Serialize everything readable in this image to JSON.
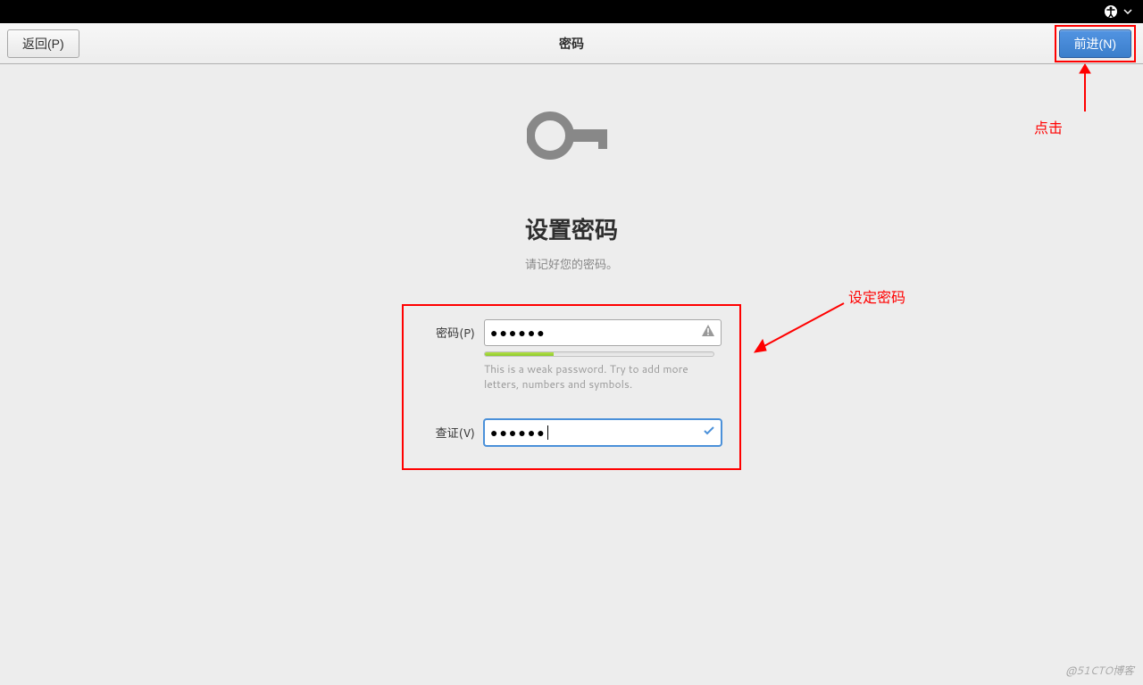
{
  "topbar": {
    "accessibility_icon": "accessibility-icon",
    "dropdown_icon": "chevron-down-icon"
  },
  "header": {
    "back_label": "返回(P)",
    "title": "密码",
    "next_label": "前进(N)"
  },
  "main": {
    "heading": "设置密码",
    "subtitle": "请记好您的密码。",
    "password_label": "密码(P)",
    "confirm_label": "查证(V)",
    "password_value": "●●●●●●",
    "confirm_value": "●●●●●●",
    "hint": "This is a weak password. Try to add more letters, numbers and symbols.",
    "strength_percent": 30
  },
  "annotations": {
    "click_label": "点击",
    "set_password_label": "设定密码"
  },
  "watermark": "@51CTO博客"
}
